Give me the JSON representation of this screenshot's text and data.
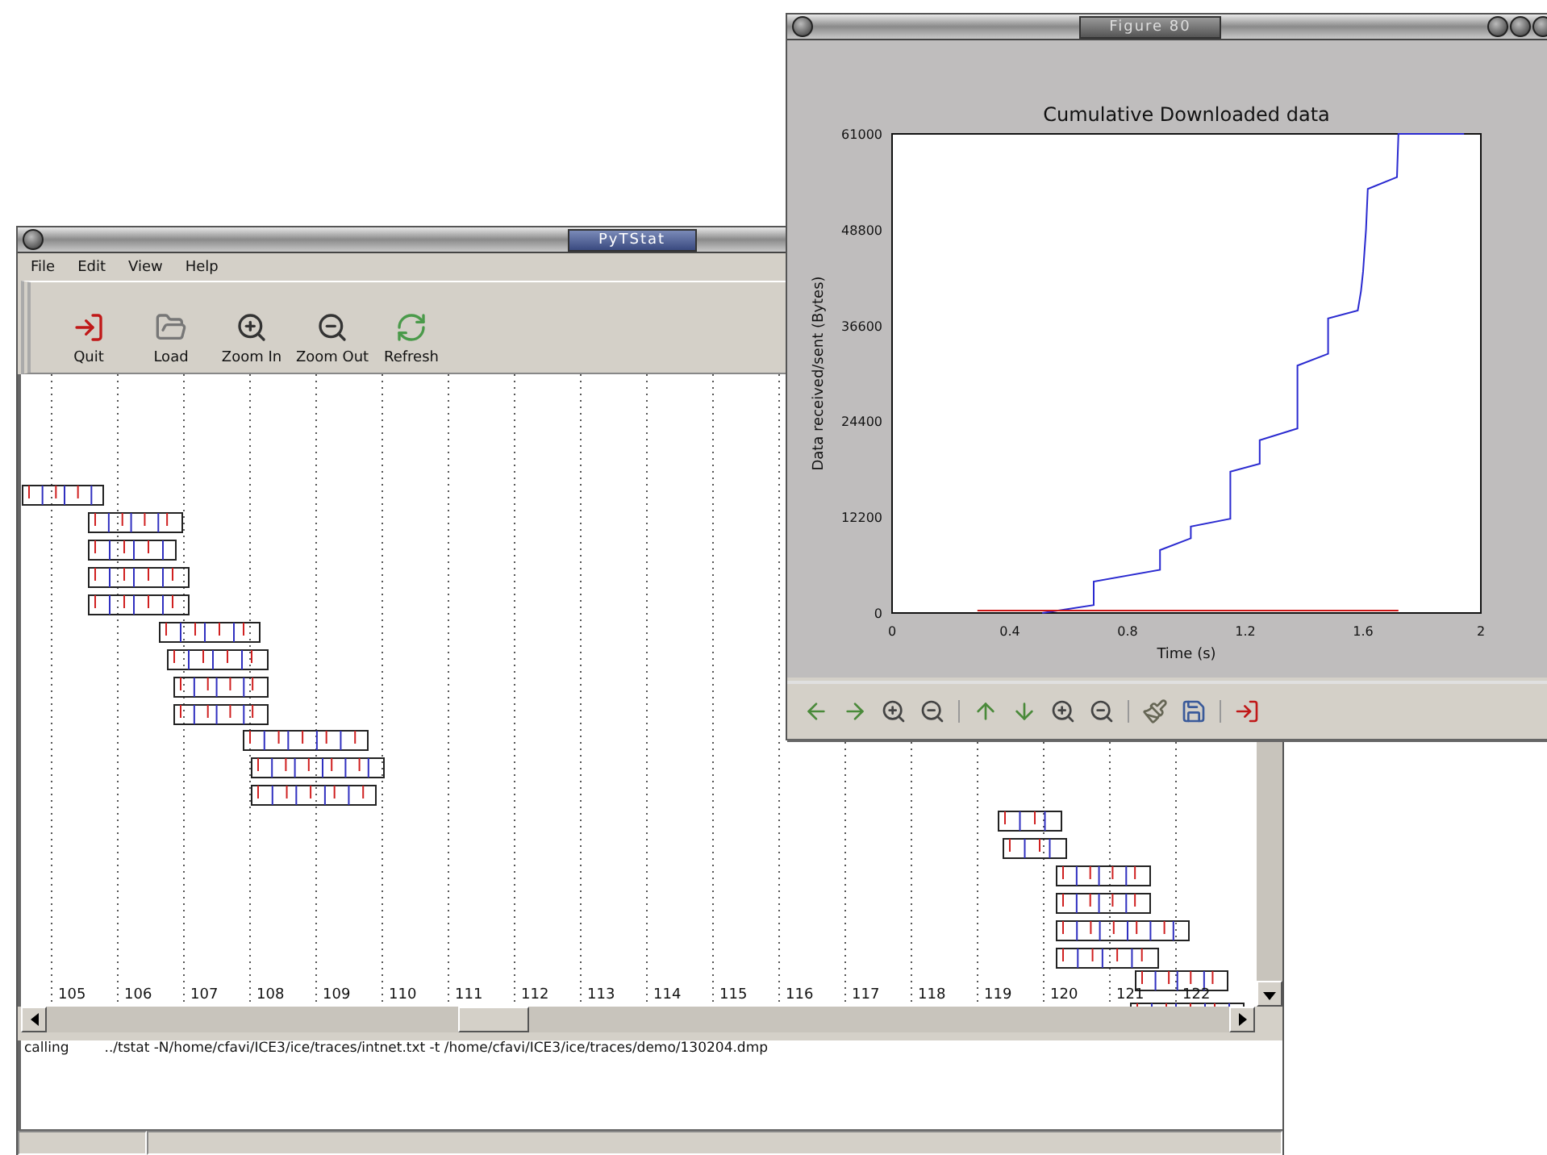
{
  "main_window": {
    "title": "PyTStat",
    "menu": [
      "File",
      "Edit",
      "View",
      "Help"
    ],
    "toolbar": [
      {
        "kind": "quit",
        "label": "Quit"
      },
      {
        "kind": "load",
        "label": "Load"
      },
      {
        "kind": "zoom_in",
        "label": "Zoom In"
      },
      {
        "kind": "zoom_out",
        "label": "Zoom Out"
      },
      {
        "kind": "refresh",
        "label": "Refresh"
      }
    ],
    "timeline": {
      "tick_labels": [
        "105",
        "106",
        "107",
        "108",
        "109",
        "110",
        "111",
        "112",
        "113",
        "114",
        "115",
        "116",
        "117",
        "118",
        "119",
        "120",
        "121",
        "122"
      ]
    },
    "log": [
      {
        "label": "calling",
        "text": "../tstat -N/home/cfavi/ICE3/ice/traces/intnet.txt -t  /home/cfavi/ICE3/ice/traces/demo/130204.dmp"
      }
    ]
  },
  "figure_window": {
    "title": "Figure 80",
    "chart_data": {
      "type": "line",
      "title": "Cumulative Downloaded data",
      "xlabel": "Time (s)",
      "ylabel": "Data received/sent (Bytes)",
      "x": [
        0.29,
        0.51,
        0.685,
        0.685,
        0.91,
        0.91,
        1.015,
        1.015,
        1.149,
        1.149,
        1.249,
        1.249,
        1.377,
        1.377,
        1.481,
        1.481,
        1.582,
        1.593,
        1.6,
        1.61,
        1.616,
        1.715,
        1.72,
        1.943
      ],
      "series": [
        {
          "color": "#2a2ad0",
          "values": [
            null,
            0,
            1000,
            4000,
            5500,
            8000,
            9500,
            11000,
            12000,
            18000,
            19000,
            22000,
            23500,
            31500,
            33000,
            37500,
            38500,
            41000,
            43500,
            48800,
            54000,
            55500,
            61000,
            61000
          ]
        },
        {
          "color": "#d01818",
          "values": [
            300,
            300,
            300,
            300,
            300,
            300,
            300,
            300,
            300,
            300,
            300,
            300,
            300,
            300,
            300,
            300,
            300,
            300,
            300,
            300,
            300,
            300,
            300,
            null
          ]
        }
      ],
      "xlim": [
        0,
        2
      ],
      "ylim": [
        0,
        61000
      ],
      "xticks": [
        0,
        0.4,
        0.8,
        1.2,
        1.6,
        2
      ],
      "yticks": [
        0,
        12200,
        24400,
        36600,
        48800,
        61000
      ]
    },
    "toolbar": [
      {
        "kind": "back"
      },
      {
        "kind": "forward"
      },
      {
        "kind": "zoom_in"
      },
      {
        "kind": "zoom_out"
      },
      {
        "kind": "sep"
      },
      {
        "kind": "up"
      },
      {
        "kind": "down"
      },
      {
        "kind": "zoom_in"
      },
      {
        "kind": "zoom_out"
      },
      {
        "kind": "sep"
      },
      {
        "kind": "brush"
      },
      {
        "kind": "save"
      },
      {
        "kind": "sep"
      },
      {
        "kind": "quit"
      }
    ]
  }
}
